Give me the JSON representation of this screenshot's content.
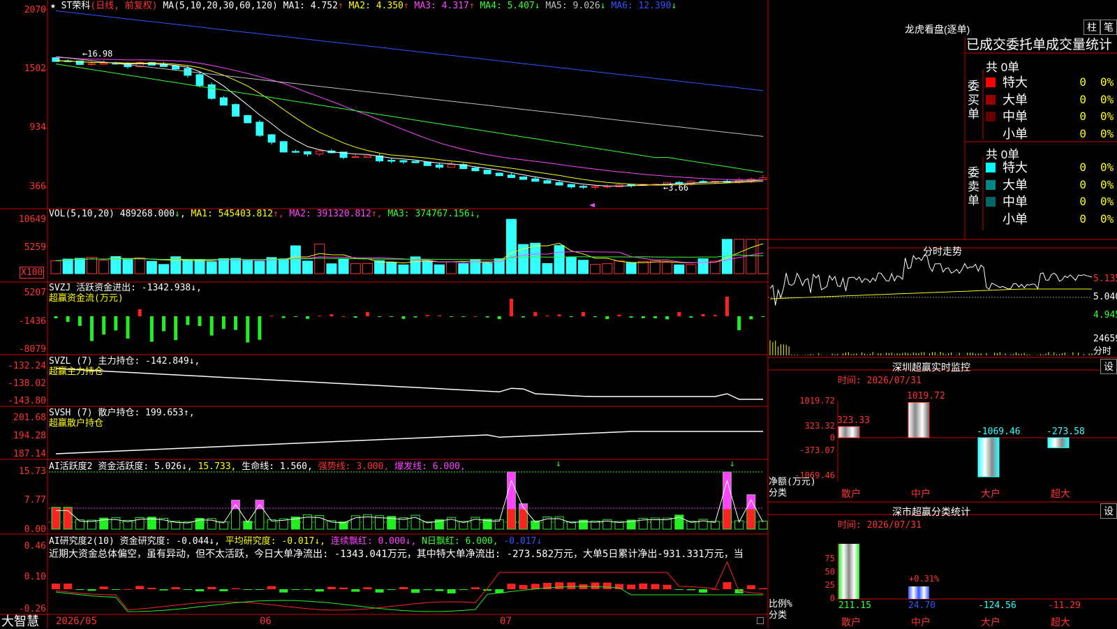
{
  "main_chart": {
    "star": "★",
    "name": "ST荣科",
    "period": "(日线, 前复权)",
    "ma_params": "MA(5,10,20,30,60,120)",
    "ma_items": [
      {
        "label": "MA1:",
        "value": "4.752",
        "arrow": "↑",
        "color": "#ffffff"
      },
      {
        "label": "MA2:",
        "value": "4.350",
        "arrow": "↑",
        "color": "#ffff00"
      },
      {
        "label": "MA3:",
        "value": "4.317",
        "arrow": "↑",
        "color": "#ff44ff"
      },
      {
        "label": "MA4:",
        "value": "5.407",
        "arrow": "↓",
        "color": "#33ff33"
      },
      {
        "label": "MA5:",
        "value": "9.026",
        "arrow": "↓",
        "color": "#c0c0c0"
      },
      {
        "label": "MA6:",
        "value": "12.390",
        "arrow": "↓",
        "color": "#3355ff"
      }
    ],
    "y_labels": [
      "2070",
      "1502",
      "934",
      "366"
    ],
    "high_label": "←16.98",
    "low_label": "←3.66"
  },
  "vol_panel": {
    "header": "VOL(5,10,20)",
    "value": "489268.000",
    "value_arrow": "↓",
    "items": [
      {
        "label": "MA1:",
        "value": "545403.812",
        "arrow": "↑",
        "color": "#ffff00"
      },
      {
        "label": "MA2:",
        "value": "391320.812",
        "arrow": "↑",
        "color": "#ff44ff"
      },
      {
        "label": "MA3:",
        "value": "374767.156",
        "arrow": "↓",
        "color": "#33ff33"
      }
    ],
    "y_labels": [
      "10649",
      "5259"
    ],
    "unit": "X100"
  },
  "svzj_panel": {
    "header": "SVZJ 活跃资金进出: -1342.938↓,",
    "subtitle": "超赢资金流(万元)",
    "y_labels": [
      "5207",
      "-1436",
      "-8079"
    ]
  },
  "svzl_panel": {
    "header": "SVZL (7) 主力持仓: -142.849↓,",
    "subtitle": "超赢主力持仓",
    "y_labels": [
      "-132.24",
      "-138.02",
      "-143.80"
    ]
  },
  "svsh_panel": {
    "header": "SVSH (7) 散户持仓: 199.653↑,",
    "subtitle": "超赢散户持仓",
    "y_labels": [
      "201.68",
      "194.28",
      "187.14"
    ]
  },
  "ai_active_panel": {
    "title": "AI活跃度2",
    "items": [
      {
        "text": "资金活跃度: 5.026↓,",
        "color": "#ffffff"
      },
      {
        "text": "15.733,",
        "color": "#ffff00"
      },
      {
        "text": "生命线: 1.560,",
        "color": "#ffffff"
      },
      {
        "text": "强势线: 3.000,",
        "color": "#ff3333"
      },
      {
        "text": "爆发线: 6.000,",
        "color": "#ff44ff"
      }
    ],
    "y_labels": [
      "15.73",
      "7.77",
      "0.00"
    ]
  },
  "ai_research_panel": {
    "title": "AI研究度2(10)",
    "items": [
      {
        "text": "资金研究度: -0.044↓,",
        "color": "#ffffff"
      },
      {
        "text": "平均研究度: -0.017↓,",
        "color": "#ffff00"
      },
      {
        "text": "连续飘红: 0.000↓,",
        "color": "#ff44ff"
      },
      {
        "text": "N日飘红: 6.000,",
        "color": "#33ff33"
      },
      {
        "text": "-0.017↓",
        "color": "#3355ff"
      }
    ],
    "comment": "近期大资金总体偏空，虽有异动，但不太活跃，今日大单净流出: -1343.041万元，其中特大单净流出: -273.582万元，大单5日累计净出-931.331万元，当",
    "y_labels": [
      "0.46",
      "0.10",
      "-0.26"
    ]
  },
  "bottom_axis": {
    "brand": "大智慧",
    "dates": [
      "2026/05",
      "06",
      "07"
    ]
  },
  "right_top": {
    "title": "龙虎看盘(逐单)",
    "btn_bar": "柱",
    "btn_pen": "笔",
    "header": "已成交委托单成交量统计",
    "buy": {
      "side_label": "委买单",
      "total": "共 0单",
      "rows": [
        {
          "color": "#ff0000",
          "label": "特大",
          "count": "0",
          "pct": "0%"
        },
        {
          "color": "#990000",
          "label": "大单",
          "count": "0",
          "pct": "0%"
        },
        {
          "color": "#660000",
          "label": "中单",
          "count": "0",
          "pct": "0%"
        },
        {
          "color": "#000000",
          "label": "小单",
          "count": "0",
          "pct": "0%"
        }
      ]
    },
    "sell": {
      "side_label": "委卖单",
      "total": "共 0单",
      "rows": [
        {
          "color": "#00ffff",
          "label": "特大",
          "count": "0",
          "pct": "0%"
        },
        {
          "color": "#008888",
          "label": "大单",
          "count": "0",
          "pct": "0%"
        },
        {
          "color": "#006666",
          "label": "中单",
          "count": "0",
          "pct": "0%"
        },
        {
          "color": "#000000",
          "label": "小单",
          "count": "0",
          "pct": "0%"
        }
      ]
    }
  },
  "intraday": {
    "title": "分时走势",
    "y_labels": [
      "5.135",
      "5.040",
      "4.945"
    ],
    "vol_label": "24659",
    "unit": "分时"
  },
  "sz_monitor": {
    "title": "深圳超赢实时监控",
    "btn": "设",
    "time": "时间: 2026/07/31",
    "y_labels": [
      "1019.72",
      "323.32",
      "0",
      "-373.07",
      "-1069.46"
    ],
    "axis_label": "净额(万元)",
    "cat_label": "分类",
    "bars": [
      {
        "name": "散户",
        "value": 323.33,
        "label": "323.33"
      },
      {
        "name": "中户",
        "value": 1019.72,
        "label": "1019.72"
      },
      {
        "name": "大户",
        "value": -1069.46,
        "label": "-1069.46"
      },
      {
        "name": "超大",
        "value": -273.58,
        "label": "-273.58"
      }
    ]
  },
  "sz_stats": {
    "title": "深市超赢分类统计",
    "btn": "设",
    "time": "时间: 2026/07/31",
    "y_labels": [
      "75",
      "50",
      "25",
      "0"
    ],
    "axis_label": "比例%",
    "cat_label": "分类",
    "bar_note": "+0.31%",
    "items": [
      {
        "name": "散户",
        "value": "211.15",
        "color": "#33ff33"
      },
      {
        "name": "中户",
        "value": "24.70",
        "color": "#3355ff"
      },
      {
        "name": "大户",
        "value": "-124.56",
        "color": "#33ffff"
      },
      {
        "name": "超大",
        "value": "-11.29",
        "color": "#ff3333"
      }
    ]
  }
}
